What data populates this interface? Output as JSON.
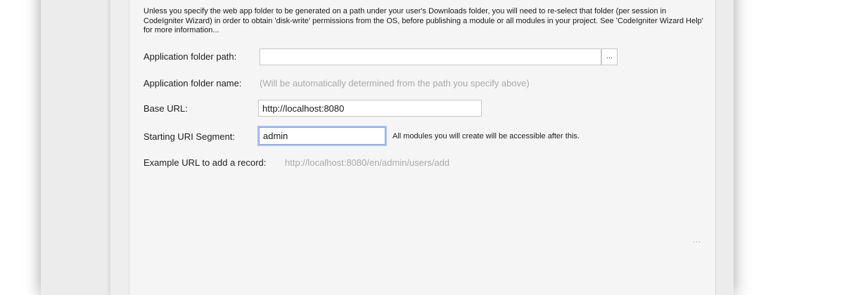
{
  "intro_note": "Unless you specify the web app folder to be generated on a path under your user's Downloads folder, you will need to re-select that folder (per session in CodeIgniter Wizard) in order to obtain 'disk-write' permissions from the OS, before publishing a module or all modules in your project. See 'CodeIgniter Wizard Help' for more information...",
  "app_folder_path": {
    "label": "Application folder path:",
    "value": "",
    "browse_label": "..."
  },
  "app_folder_name": {
    "label": "Application folder name:",
    "hint": "(Will be automatically determined from the path you specify above)"
  },
  "base_url": {
    "label": "Base URL:",
    "value": "http://localhost:8080"
  },
  "starting_uri_segment": {
    "label": "Starting URI Segment:",
    "value": "admin",
    "hint": "All modules you will create will be accessible after this."
  },
  "example_url": {
    "label": "Example URL to add a record:",
    "value": "http://localhost:8080/en/admin/users/add"
  },
  "window_dots": "..."
}
